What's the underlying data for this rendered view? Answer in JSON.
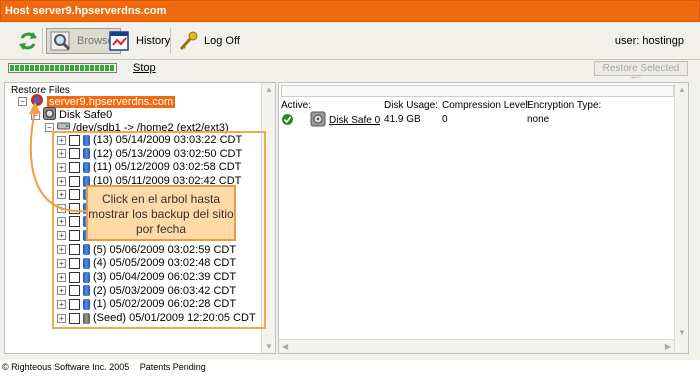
{
  "window": {
    "title": "Host server9.hpserverdns.com"
  },
  "toolbar": {
    "browse_label": "Browse",
    "history_label": "History",
    "logoff_label": "Log Off",
    "user_text": "user: hostingp"
  },
  "progress": {
    "fraction": 1.0,
    "stop_label": "Stop",
    "restore_selected_label": "Restore Selected Files"
  },
  "left_panel": {
    "header": "Restore Files",
    "server": "server9.hpserverdns.com",
    "disk": "Disk Safe0",
    "device": "/dev/sdb1 -> /home2 (ext2/ext3)",
    "backups": [
      "(13) 05/14/2009 03:03:22 CDT",
      "(12) 05/13/2009 03:02:50 CDT",
      "(11) 05/12/2009 03:02:58 CDT",
      "(10) 05/11/2009 03:02:42 CDT",
      "",
      "",
      "",
      "",
      "(5) 05/06/2009 03:02:59 CDT",
      "(4) 05/05/2009 03:02:48 CDT",
      "(3) 05/04/2009 06:02:39 CDT",
      "(2) 05/03/2009 06:03:42 CDT",
      "(1) 05/02/2009 06:02:28 CDT",
      "(Seed) 05/01/2009 12:20:05 CDT"
    ]
  },
  "callout": {
    "text": "Click en el arbol hasta mostrar los backup del sitio por fecha"
  },
  "right_panel": {
    "columns": [
      "Active:",
      "Disk Usage:",
      "Compression Level:",
      "Encryption Type:"
    ],
    "row": {
      "name": "Disk Safe 0",
      "usage": "41.9 GB",
      "compression": "0",
      "encryption": "none"
    }
  },
  "footer": {
    "copyright": "© Righteous Software Inc. 2005",
    "patents": "Patents Pending"
  },
  "colors": {
    "brand": "#f26a10",
    "progress": "#2fb12f",
    "callout_bg": "#ffd9a6",
    "highlight_box": "#f5a84a"
  },
  "icons": [
    "refresh-icon",
    "browse-icon",
    "history-icon",
    "logoff-key-icon",
    "check-icon",
    "disk-icon",
    "database-icon"
  ]
}
